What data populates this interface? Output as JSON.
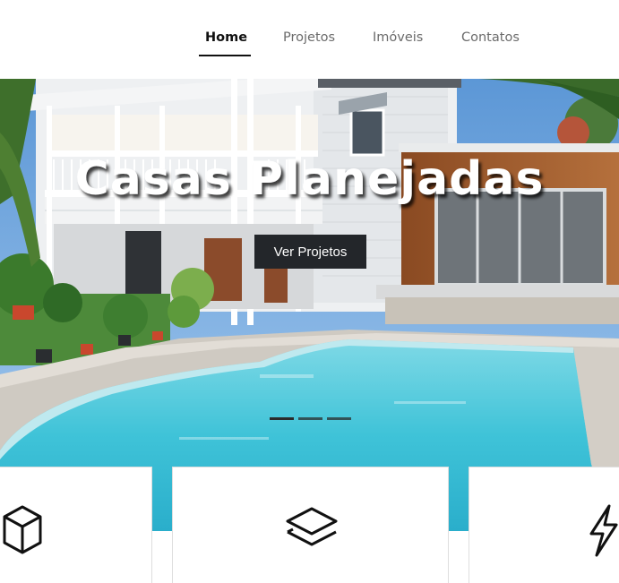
{
  "nav": {
    "items": [
      {
        "label": "Home",
        "active": true
      },
      {
        "label": "Projetos",
        "active": false
      },
      {
        "label": "Imóveis",
        "active": false
      },
      {
        "label": "Contatos",
        "active": false
      }
    ]
  },
  "hero": {
    "title": "Casas Planejadas",
    "button_label": "Ver Projetos",
    "slide_count": 3,
    "active_slide": 1
  },
  "features": {
    "icons": [
      "cube-icon",
      "layers-icon",
      "lightning-icon"
    ]
  },
  "colors": {
    "button_bg": "#23262a",
    "nav_active": "#111111",
    "nav_inactive": "#6b6b6b",
    "pool": "#3fc3d8"
  }
}
